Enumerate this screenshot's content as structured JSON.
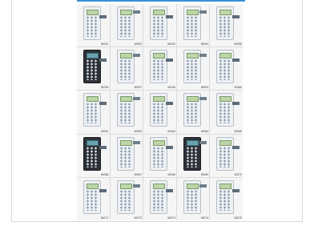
{
  "catalog": {
    "codes": [
      "W001",
      "W002",
      "W003",
      "W004",
      "W005",
      "W006",
      "W007",
      "W008",
      "W009",
      "W060",
      "W061",
      "W062",
      "W063",
      "W064",
      "W065",
      "W066",
      "W067",
      "W068",
      "W069",
      "W070",
      "W071",
      "W072",
      "W073",
      "W074",
      "W075"
    ]
  },
  "colors": {
    "accent": "#3a8fd8",
    "tile_background": "#f5f5f5"
  }
}
